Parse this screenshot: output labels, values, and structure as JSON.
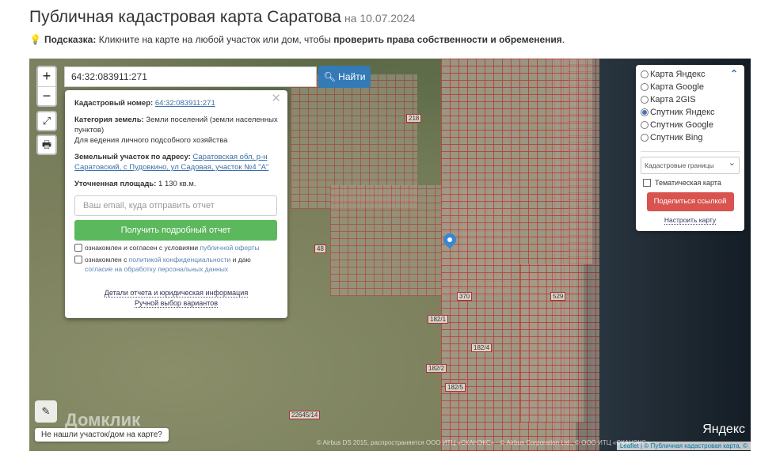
{
  "header": {
    "title": "Публичная кадастровая карта Саратова",
    "date": "на 10.07.2024"
  },
  "hint": {
    "label": "Подсказка:",
    "text": "Кликните на карте на любой участок или дом, чтобы",
    "bold": "проверить права собственности и обременения",
    "end": "."
  },
  "search": {
    "value": "64:32:083911:271",
    "button": "Найти"
  },
  "popup": {
    "cad_label": "Кадастровый номер:",
    "cad_value": "64:32:083911:271",
    "cat_label": "Категория земель:",
    "cat_value": "Земли поселений (земли населенных пунктов)",
    "use": "Для ведения личного подсобного хозяйства",
    "addr_label": "Земельный участок по адресу:",
    "addr_value": "Саратовская обл, р-н Саратовский, с Пудовкино, ул Садовая, участок №4 \"А\"",
    "area_label": "Уточненная площадь:",
    "area_value": "1 130 кв.м.",
    "email_placeholder": "Ваш email, куда отправить отчет",
    "get_button": "Получить подробный отчет",
    "chk1_text": "ознакомлен и согласен с условиями",
    "chk1_link": "публичной оферты",
    "chk2_text": "ознакомлен с",
    "chk2_link": "политикой конфиденциальности",
    "chk2_mid": "и даю",
    "chk2_link2": "согласие на обработку персональных данных",
    "details_link": "Детали отчета и юридическая информация",
    "manual_link": "Ручной выбор вариантов"
  },
  "layers": {
    "options": [
      "Карта Яндекс",
      "Карта Google",
      "Карта 2GIS",
      "Спутник Яндекс",
      "Спутник Google",
      "Спутник Bing"
    ],
    "selected": "Спутник Яндекс",
    "overlay_select": "Кадастровые границы",
    "thematic": "Тематическая карта",
    "share": "Поделиться ссылкой",
    "configure": "Настроить карту"
  },
  "map": {
    "labels": [
      "218",
      "370",
      "182/1",
      "182/4",
      "182/2",
      "182/5",
      "22645/14",
      "48",
      "529"
    ],
    "not_found": "Не нашли участок/дом на карте?",
    "watermark": "Домклик",
    "yandex": "Яндекс",
    "attribution": "© Airbus DS 2015, распространяется ООО ИТЦ «СКАНЭКС» · © Airbus Corporation Ltd., © ООО ИТЦ «СКАНЭКС»",
    "leaflet": "Leaflet | © Публичная кадастровая карта, ©"
  }
}
